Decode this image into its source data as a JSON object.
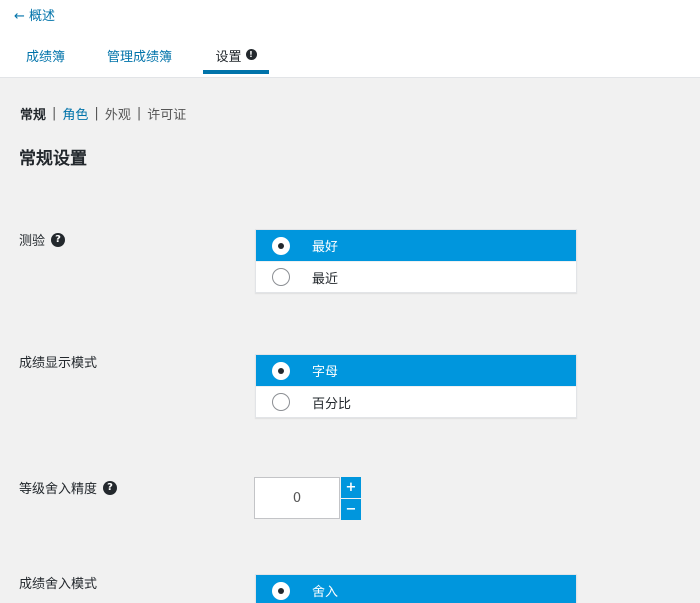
{
  "nav": {
    "back_label": "← 概述",
    "tabs": [
      {
        "label": "成绩簿"
      },
      {
        "label": "管理成绩簿"
      },
      {
        "label": "设置",
        "badge": "!"
      }
    ]
  },
  "subnav": {
    "items": [
      {
        "label": "常规"
      },
      {
        "label": "角色"
      },
      {
        "label": "外观"
      },
      {
        "label": "许可证"
      }
    ],
    "separator": "|"
  },
  "section_title": "常规设置",
  "fields": {
    "test": {
      "label": "测验",
      "help": "?",
      "options": [
        {
          "label": "最好",
          "selected": true
        },
        {
          "label": "最近",
          "selected": false
        }
      ]
    },
    "grade_display": {
      "label": "成绩显示模式",
      "options": [
        {
          "label": "字母",
          "selected": true
        },
        {
          "label": "百分比",
          "selected": false
        }
      ]
    },
    "rounding_precision": {
      "label": "等级舍入精度",
      "help": "?",
      "value": "0",
      "plus": "+",
      "minus": "−"
    },
    "rounding_mode": {
      "label": "成绩舍入模式",
      "options": [
        {
          "label": "舍入",
          "selected": true
        }
      ]
    }
  },
  "colors": {
    "accent": "#0096dd",
    "link": "#0073aa",
    "background": "#f1f1f1"
  }
}
